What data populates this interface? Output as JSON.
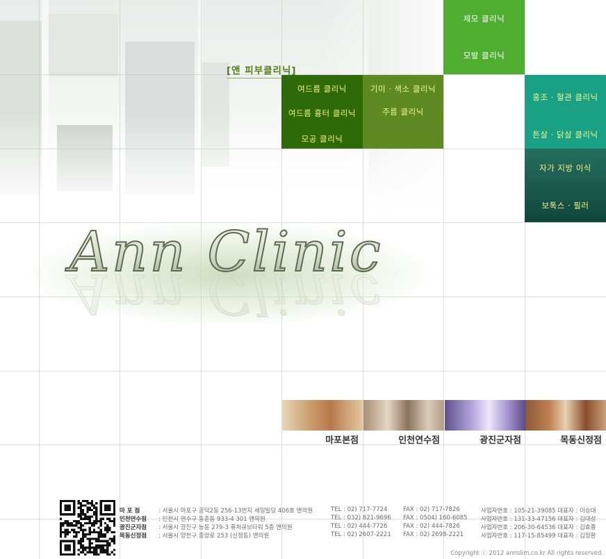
{
  "section_label": "[앤 피부클리닉]",
  "menu": {
    "acne": [
      "여드름 클리닉",
      "여드름 흉터 클리닉",
      "모공 클리닉"
    ],
    "pigment": [
      "기미 · 색소 클리닉",
      "주름 클리닉"
    ],
    "hair": [
      "제모 클리닉",
      "모발 클리닉"
    ],
    "vascular": [
      "홍조 · 혈관 클리닉",
      "튼살 · 닭살 클리닉"
    ],
    "fat": [
      "자가 지방 이식",
      "보톡스 · 필러"
    ]
  },
  "logo_text": "Ann Clinic",
  "branches": [
    "마포본점",
    "인천연수점",
    "광진군자점",
    "목동신정점"
  ],
  "footer": {
    "rows": [
      {
        "name": "마 포 점",
        "address": ": 서울시 마포구 공덕2동 256-13번지 세일빌딩 406호 앤의원",
        "tel": "TEL : 02) 717-7724",
        "fax": "FAX : 02) 717-7826",
        "biz": "사업자번호 : 105-21-39085  대표자 : 이승대"
      },
      {
        "name": "인천연수점",
        "address": ": 인천시 연수구 동춘동 933-4 301 앤의원",
        "tel": "TEL : 032) 821-9696",
        "fax": "FAX : 0504) 160-6085",
        "biz": "사업자번호 : 131-33-47156  대표자 : 김대성"
      },
      {
        "name": "광진군자점",
        "address": ": 서울시 광진구 능동 279-3 퓨처큐브타워 5층 앤의원",
        "tel": "TEL : 02) 444-7726",
        "fax": "FAX : 02) 444-7826",
        "biz": "사업자번호 : 206-30-64536  대표자 : 김효종"
      },
      {
        "name": "목동신정점",
        "address": ": 서울시 양천구 중앙로 253 (신정동) 앤의원",
        "tel": "TEL : 02) 2607-2221",
        "fax": "FAX : 02) 2698-2221",
        "biz": "사업자번호 : 117-15-85499  대표자 : 김정환"
      }
    ],
    "copyright": "Copyright ⓒ 2012 annslim.co.kr All rights reserved."
  },
  "colors": {
    "green_bright": "#4fad2f",
    "green_dark": "#2f6a08",
    "green_olive": "#5e8a24",
    "teal": "#1aa085",
    "teal_dark": "#13594b",
    "menu_text": "#f1f58a"
  }
}
